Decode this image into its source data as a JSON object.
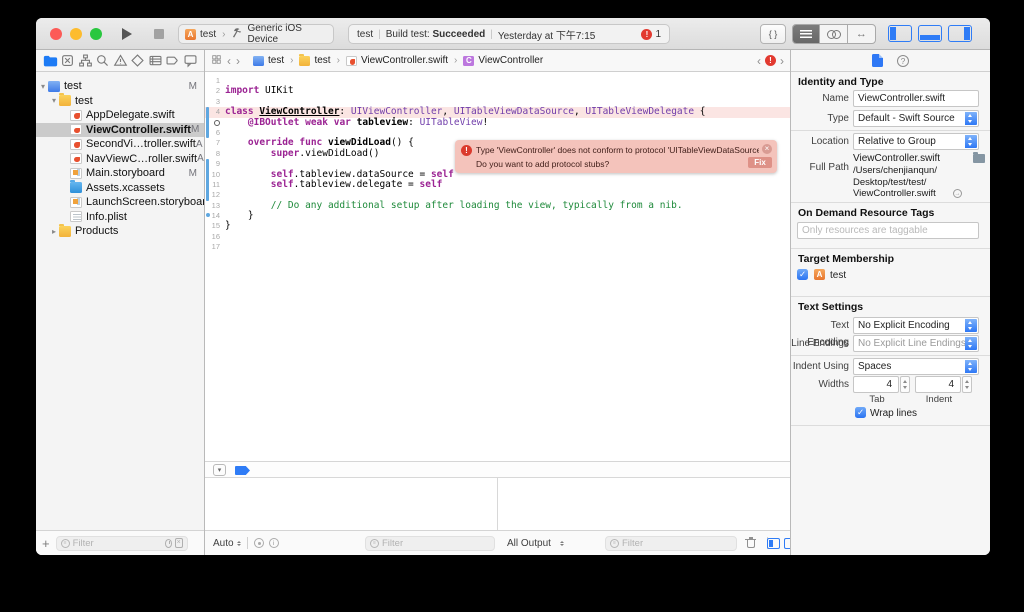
{
  "titlebar": {
    "scheme": {
      "target": "test",
      "destination": "Generic iOS Device"
    },
    "status": {
      "project": "test",
      "build_prefix": "Build test:",
      "build_result": "Succeeded",
      "time": "Yesterday at 下午7:15",
      "issue_count": "1"
    },
    "code_review_glyph": "{ }"
  },
  "navigator": {
    "filter_placeholder": "Filter",
    "tabs": [
      "project-navigator-icon",
      "source-control-icon",
      "symbol-navigator-icon",
      "find-navigator-icon",
      "issue-navigator-icon",
      "test-navigator-icon",
      "debug-navigator-icon",
      "breakpoint-navigator-icon",
      "report-navigator-icon"
    ],
    "selected_tab": 0,
    "items": [
      {
        "level": 0,
        "disclosure": "open",
        "icon": "project-icon",
        "label": "test",
        "badge": "M",
        "selected": false
      },
      {
        "level": 1,
        "disclosure": "open",
        "icon": "folder-icon",
        "label": "test",
        "badge": "",
        "selected": false
      },
      {
        "level": 2,
        "disclosure": "none",
        "icon": "swift-file-icon",
        "label": "AppDelegate.swift",
        "badge": "",
        "selected": false
      },
      {
        "level": 2,
        "disclosure": "none",
        "icon": "swift-file-icon",
        "label": "ViewController.swift",
        "badge": "M",
        "selected": true
      },
      {
        "level": 2,
        "disclosure": "none",
        "icon": "swift-file-icon",
        "label": "SecondVi…troller.swift",
        "badge": "A",
        "selected": false
      },
      {
        "level": 2,
        "disclosure": "none",
        "icon": "swift-file-icon",
        "label": "NavViewC…roller.swift",
        "badge": "A",
        "selected": false
      },
      {
        "level": 2,
        "disclosure": "none",
        "icon": "storyboard-icon",
        "label": "Main.storyboard",
        "badge": "M",
        "selected": false
      },
      {
        "level": 2,
        "disclosure": "none",
        "icon": "xcassets-icon",
        "label": "Assets.xcassets",
        "badge": "",
        "selected": false
      },
      {
        "level": 2,
        "disclosure": "none",
        "icon": "storyboard-icon",
        "label": "LaunchScreen.storyboard",
        "badge": "",
        "selected": false
      },
      {
        "level": 2,
        "disclosure": "none",
        "icon": "plist-icon",
        "label": "Info.plist",
        "badge": "",
        "selected": false
      },
      {
        "level": 1,
        "disclosure": "closed",
        "icon": "folder-icon",
        "label": "Products",
        "badge": "",
        "selected": false
      }
    ]
  },
  "jump_bar": {
    "crumbs": [
      {
        "icon": "project-icon",
        "icon_glyph": "",
        "label": "test"
      },
      {
        "icon": "folder-icon",
        "icon_glyph": "",
        "label": "test"
      },
      {
        "icon": "swift-file-icon",
        "icon_glyph": "",
        "label": "ViewController.swift"
      },
      {
        "icon": "class-icon",
        "icon_glyph": "C",
        "label": "ViewController"
      }
    ]
  },
  "editor": {
    "lines": [
      {
        "n": "1",
        "tokens": []
      },
      {
        "n": "2",
        "tokens": [
          {
            "c": "k",
            "t": "import"
          },
          {
            "c": "p",
            "t": " UIKit"
          }
        ]
      },
      {
        "n": "3",
        "tokens": []
      },
      {
        "n": "4",
        "tokens": [
          {
            "c": "k",
            "t": "class"
          },
          {
            "c": "p",
            "t": " "
          },
          {
            "c": "du",
            "t": "ViewController"
          },
          {
            "c": "p",
            "t": ": "
          },
          {
            "c": "t",
            "t": "UIViewController"
          },
          {
            "c": "p",
            "t": ", "
          },
          {
            "c": "t",
            "t": "UITableViewDataSource"
          },
          {
            "c": "p",
            "t": ", "
          },
          {
            "c": "t",
            "t": "UITableViewDelegate"
          },
          {
            "c": "p",
            "t": " {"
          }
        ]
      },
      {
        "n": "5",
        "tokens": [
          {
            "c": "p",
            "t": "    "
          },
          {
            "c": "k",
            "t": "@IBOutlet"
          },
          {
            "c": "p",
            "t": " "
          },
          {
            "c": "k",
            "t": "weak"
          },
          {
            "c": "p",
            "t": " "
          },
          {
            "c": "k",
            "t": "var"
          },
          {
            "c": "p",
            "t": " "
          },
          {
            "c": "d",
            "t": "tableview"
          },
          {
            "c": "p",
            "t": ": "
          },
          {
            "c": "t",
            "t": "UITableView"
          },
          {
            "c": "p",
            "t": "!"
          }
        ]
      },
      {
        "n": "6",
        "tokens": []
      },
      {
        "n": "7",
        "tokens": [
          {
            "c": "p",
            "t": "    "
          },
          {
            "c": "k",
            "t": "override"
          },
          {
            "c": "p",
            "t": " "
          },
          {
            "c": "k",
            "t": "func"
          },
          {
            "c": "p",
            "t": " "
          },
          {
            "c": "d",
            "t": "viewDidLoad"
          },
          {
            "c": "p",
            "t": "() {"
          }
        ]
      },
      {
        "n": "8",
        "tokens": [
          {
            "c": "p",
            "t": "        "
          },
          {
            "c": "k",
            "t": "super"
          },
          {
            "c": "p",
            "t": ".viewDidLoad()"
          }
        ]
      },
      {
        "n": "9",
        "tokens": []
      },
      {
        "n": "10",
        "tokens": [
          {
            "c": "p",
            "t": "        "
          },
          {
            "c": "k",
            "t": "self"
          },
          {
            "c": "p",
            "t": ".tableview.dataSource = "
          },
          {
            "c": "k",
            "t": "self"
          }
        ]
      },
      {
        "n": "11",
        "tokens": [
          {
            "c": "p",
            "t": "        "
          },
          {
            "c": "k",
            "t": "self"
          },
          {
            "c": "p",
            "t": ".tableview.delegate = "
          },
          {
            "c": "k",
            "t": "self"
          }
        ]
      },
      {
        "n": "12",
        "tokens": []
      },
      {
        "n": "13",
        "tokens": [
          {
            "c": "p",
            "t": "        "
          },
          {
            "c": "c",
            "t": "// Do any additional setup after loading the view, typically from a nib."
          }
        ]
      },
      {
        "n": "14",
        "tokens": [
          {
            "c": "p",
            "t": "    }"
          }
        ]
      },
      {
        "n": "15",
        "tokens": [
          {
            "c": "p",
            "t": "}"
          }
        ]
      },
      {
        "n": "16",
        "tokens": []
      },
      {
        "n": "17",
        "tokens": []
      }
    ],
    "decor": {
      "error_line": 4,
      "outlet_line": 5,
      "change_bars": [
        [
          4,
          6
        ],
        [
          9,
          12
        ]
      ],
      "dot_line": 14
    },
    "banner": {
      "line1": "Type 'ViewController' does not conform to protocol 'UITableViewDataSource'",
      "line2": "Do you want to add protocol stubs?",
      "fix_label": "Fix"
    }
  },
  "debug": {
    "scope_label": "Auto",
    "output_label": "All Output",
    "filter_placeholder": "Filter"
  },
  "inspector": {
    "identity": {
      "header": "Identity and Type",
      "name_label": "Name",
      "name_value": "ViewController.swift",
      "type_label": "Type",
      "type_value": "Default - Swift Source",
      "location_label": "Location",
      "location_value": "Relative to Group",
      "file_name": "ViewController.swift",
      "full_path_label": "Full Path",
      "full_path_lines": [
        "/Users/chenjianqun/",
        "Desktop/test/test/",
        "ViewController.swift"
      ]
    },
    "odr": {
      "header": "On Demand Resource Tags",
      "placeholder": "Only resources are taggable"
    },
    "target": {
      "header": "Target Membership",
      "target_name": "test"
    },
    "text_settings": {
      "header": "Text Settings",
      "encoding_label": "Text Encoding",
      "encoding_value": "No Explicit Encoding",
      "line_endings_label": "Line Endings",
      "line_endings_value": "No Explicit Line Endings",
      "indent_label": "Indent Using",
      "indent_value": "Spaces",
      "widths_label": "Widths",
      "tab_value": "4",
      "indent_width_value": "4",
      "tab_caption": "Tab",
      "indent_caption": "Indent",
      "wrap_label": "Wrap lines"
    }
  },
  "colors": {
    "accent": "#1D7BF5",
    "error_red": "#E23A30",
    "banner_bg": "#F4C3BB",
    "keyword": "#9B2393",
    "type": "#703DAA",
    "comment": "#1F8A3B",
    "change_bar": "#5FA7E0"
  }
}
